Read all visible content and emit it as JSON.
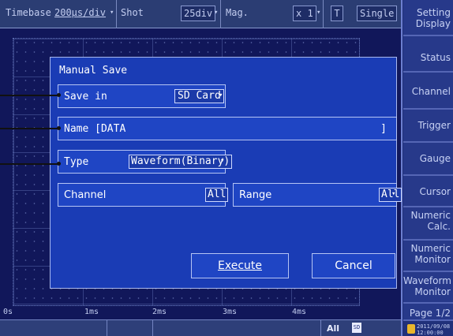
{
  "topbar": {
    "timebase_label": "Timebase",
    "timebase_value": "200μs/div",
    "shot_label": "Shot",
    "shot_value": "25div",
    "mag_label": "Mag.",
    "mag_value": "x 1",
    "trigger_icon": "T",
    "mode_value": "Single"
  },
  "side_menu": [
    {
      "line1": "Setting",
      "line2": "Display"
    },
    {
      "line1": "Status",
      "line2": ""
    },
    {
      "line1": "Channel",
      "line2": ""
    },
    {
      "line1": "Trigger",
      "line2": ""
    },
    {
      "line1": "Gauge",
      "line2": ""
    },
    {
      "line1": "Cursor",
      "line2": ""
    },
    {
      "line1": "Numeric",
      "line2": "Calc."
    },
    {
      "line1": "Numeric",
      "line2": "Monitor"
    },
    {
      "line1": "Waveform",
      "line2": "Monitor"
    },
    {
      "line1": "Page 1/2",
      "line2": ""
    }
  ],
  "time_axis": [
    "0s",
    "1ms",
    "2ms",
    "3ms",
    "4ms"
  ],
  "bottombar": {
    "all_label": "All",
    "sd_badge": "SD",
    "date": "2011/09/08",
    "time": "12:00:00"
  },
  "dialog": {
    "title": "Manual Save",
    "save_in_label": "Save in",
    "save_in_value": "SD Card",
    "name_label": "Name [DATA",
    "name_close": "]",
    "type_label": "Type",
    "type_value": "Waveform(Binary)",
    "channel_label": "Channel",
    "channel_value": "All",
    "range_label": "Range",
    "range_value": "All",
    "execute_label": "Execute",
    "cancel_label": "Cancel"
  },
  "colors": {
    "screen_bg": "#11175a",
    "dialog_bg": "#1a3cb5",
    "accent": "#b5c4f4"
  }
}
